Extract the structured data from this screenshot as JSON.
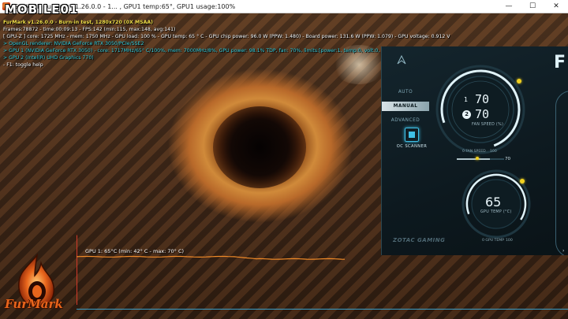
{
  "watermark": {
    "logo_text": "MOBILE01"
  },
  "window": {
    "title": "Geeks3D FurMark v1.26.0.0 - 1... , GPU1 temp:65°, GPU1 usage:100%",
    "minimize_glyph": "—",
    "maximize_glyph": "☐",
    "close_glyph": "✕"
  },
  "hud": {
    "line1": "FurMark v1.26.0.0 - Burn-in test, 1280x720 (0X MSAA)",
    "line2": "Frames:78872 - time:00:09:13 - FPS:142 (min:115, max:148, avg:141)",
    "line3": "[ GPU-Z ] core: 1725 MHz - mem: 1750 MHz - GPU load: 100 % - GPU temp: 65 ° C - GPU chip power: 96.0 W (PPW: 1.480) - Board power: 131.6 W (PPW: 1.079) - GPU voltage: 0.912 V",
    "line4": "> OpenGL renderer: NVIDIA GeForce RTX 3050/PCIe/SSE2",
    "line5": "> GPU 1 (NVIDIA GeForce RTX 3050) - core: 1717MHz/65° C/100%, mem: 7000MHz/8%, GPU power: 98.1% TDP, fan: 70%, limits:[power:1, temp:0, volt:0, OV:0]",
    "line6": "> GPU 2 (Intel(R) UHD Graphics 770)",
    "line7": "- F1: toggle help"
  },
  "graph": {
    "label": "GPU 1: 65°C (min: 42° C - max: 70° C)",
    "min_temp": 42,
    "max_temp": 70,
    "current_temp": 65
  },
  "furmark_logo": {
    "text": "FurMark"
  },
  "zotac": {
    "modes": [
      {
        "label": "AUTO",
        "active": false
      },
      {
        "label": "MANUAL",
        "active": true
      },
      {
        "label": "ADVANCED",
        "active": false
      }
    ],
    "oc_scanner_label": "OC SCANNER",
    "fan": {
      "idx1": "1",
      "idx2": "2",
      "value1": "70",
      "value2": "70",
      "label": "FAN SPEED (%)",
      "scale_min": "0 FAN SPEED",
      "scale_max": "100",
      "slider_value": "70"
    },
    "gpu_temp": {
      "value": "65",
      "label": "GPU TEMP (°C)",
      "scale_min": "0 GPU TEMP",
      "scale_max": "100"
    },
    "brand": "ZOTAC GAMING",
    "corner_letter": "F",
    "corner_mark": "›"
  }
}
